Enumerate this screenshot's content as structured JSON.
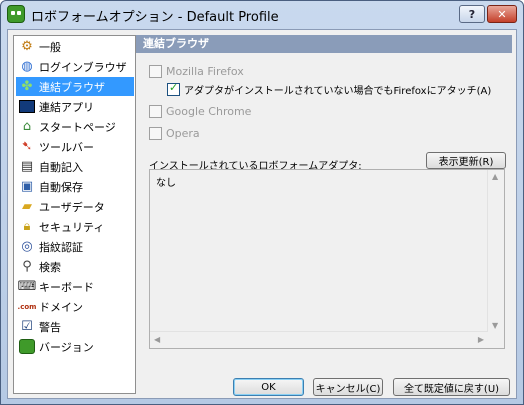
{
  "window": {
    "title": "ロボフォームオプション - Default Profile",
    "help_label": "?",
    "close_label": "✕"
  },
  "sidebar": {
    "items": [
      {
        "label": "一般",
        "icon": "gear-icon"
      },
      {
        "label": "ログインブラウザ",
        "icon": "globe-icon"
      },
      {
        "label": "連結ブラウザ",
        "icon": "puzzle-icon"
      },
      {
        "label": "連結アプリ",
        "icon": "application-icon"
      },
      {
        "label": "スタートページ",
        "icon": "home-icon"
      },
      {
        "label": "ツールバー",
        "icon": "toolbar-icon"
      },
      {
        "label": "自動記入",
        "icon": "autofill-icon"
      },
      {
        "label": "自動保存",
        "icon": "save-icon"
      },
      {
        "label": "ユーザデータ",
        "icon": "folder-icon"
      },
      {
        "label": "セキュリティ",
        "icon": "lock-icon"
      },
      {
        "label": "指紋認証",
        "icon": "fingerprint-icon"
      },
      {
        "label": "検索",
        "icon": "magnifier-icon"
      },
      {
        "label": "キーボード",
        "icon": "keyboard-icon"
      },
      {
        "label": "ドメイン",
        "icon": "com-icon"
      },
      {
        "label": "警告",
        "icon": "checkbox-warning-icon"
      },
      {
        "label": "バージョン",
        "icon": "robot-icon"
      }
    ],
    "selected": "連結ブラウザ"
  },
  "main": {
    "section_title": "連結ブラウザ",
    "browsers": [
      {
        "label": "Mozilla Firefox",
        "checked": false,
        "enabled": false
      },
      {
        "label": "アダプタがインストールされていない場合でもFirefoxにアタッチ(A)",
        "checked": true,
        "enabled": true
      },
      {
        "label": "Google Chrome",
        "checked": false,
        "enabled": false
      },
      {
        "label": "Opera",
        "checked": false,
        "enabled": false
      }
    ],
    "adapter_label": "インストールされているロボフォームアダプタ:",
    "refresh_button": "表示更新(R)",
    "adapter_list_text": "なし"
  },
  "buttons": {
    "ok": "OK",
    "cancel": "キャンセル(C)",
    "reset": "全て既定値に戻す(U)"
  },
  "colors": {
    "selected": "#3399ff",
    "header": "#8a9cb9"
  }
}
